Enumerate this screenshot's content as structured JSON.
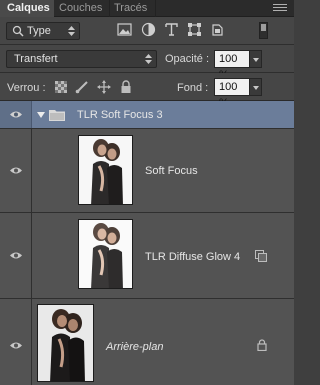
{
  "tabs": [
    {
      "label": "Calques",
      "active": true
    },
    {
      "label": "Couches",
      "active": false
    },
    {
      "label": "Tracés",
      "active": false
    }
  ],
  "filter": {
    "kind_label": "Type",
    "icons": [
      "image-filter-icon",
      "adjustment-filter-icon",
      "type-filter-icon",
      "shape-filter-icon",
      "smart-object-filter-icon"
    ]
  },
  "blend": {
    "mode": "Transfert",
    "opacity_label": "Opacité :",
    "opacity_value": "100 %",
    "fill_label": "Fond :",
    "fill_value": "100 %"
  },
  "lock": {
    "label": "Verrou :",
    "icons": [
      "lock-transparency-icon",
      "lock-pixels-icon",
      "lock-position-icon",
      "lock-all-icon"
    ]
  },
  "layers": [
    {
      "name": "TLR Soft Focus 3",
      "type": "group",
      "selected": true,
      "visible": true
    },
    {
      "name": "Soft Focus",
      "type": "layer",
      "visible": true,
      "badge": ""
    },
    {
      "name": "TLR Diffuse Glow 4",
      "type": "layer",
      "visible": true,
      "badge": "smart-object-icon"
    },
    {
      "name": "Arrière-plan",
      "type": "background",
      "visible": true,
      "badge": "lock-icon"
    }
  ],
  "colors": {
    "panel": "#535353",
    "selection": "#6b7d9a",
    "tab_bar": "#2b2b2b"
  }
}
